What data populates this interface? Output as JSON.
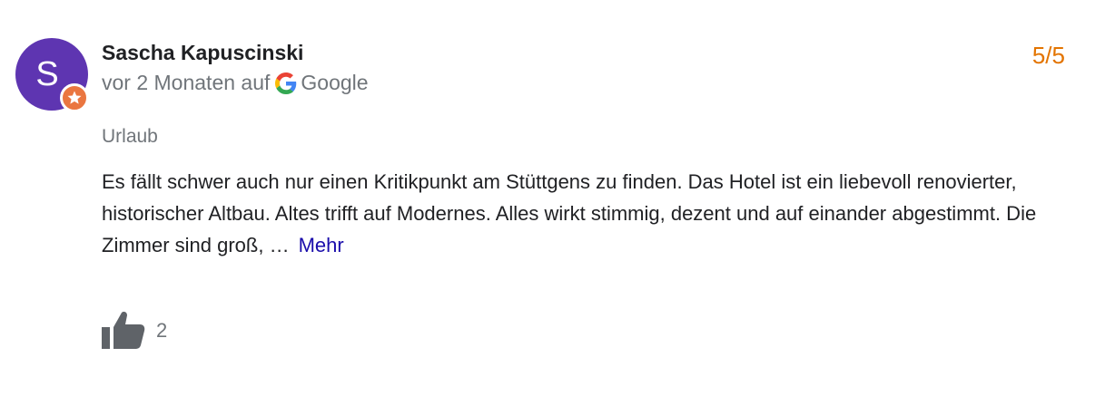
{
  "review": {
    "author": "Sascha Kapuscinski",
    "avatar_letter": "S",
    "posted_prefix": "vor 2 Monaten auf",
    "source": "Google",
    "rating": "5/5",
    "trip_type": "Urlaub",
    "text": "Es fällt schwer auch nur einen Kritikpunkt am Stüttgens zu finden. Das Hotel ist ein liebevoll renovierter, historischer Altbau. Altes trifft auf Modernes. Alles wirkt stimmig, dezent und auf einander abgestimmt. Die Zimmer sind groß, …",
    "more_label": "Mehr",
    "like_count": "2"
  },
  "colors": {
    "avatar": "#5e35b1",
    "badge": "#ea7640",
    "rating": "#e37400",
    "link": "#1a0dab"
  },
  "icons": {
    "badge": "star-icon",
    "source": "google-g-icon",
    "like": "thumbs-up-icon"
  }
}
